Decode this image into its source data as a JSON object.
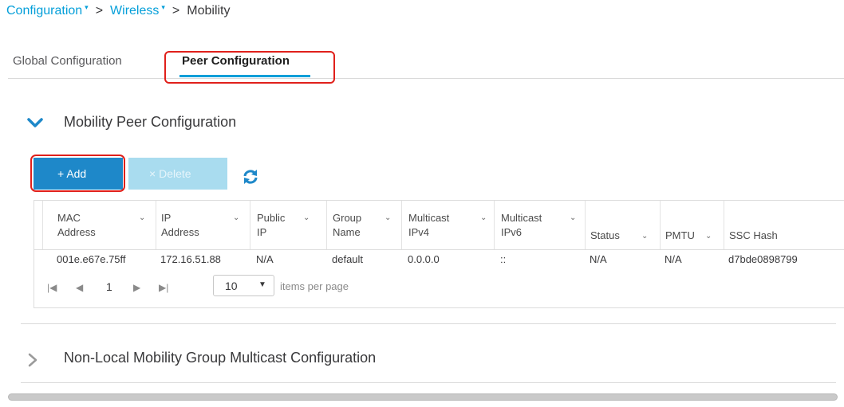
{
  "breadcrumb": {
    "items": [
      "Configuration",
      "Wireless",
      "Mobility"
    ],
    "caret": "▾",
    "separator": ">"
  },
  "tabs": [
    {
      "label": "Global Configuration",
      "active": false
    },
    {
      "label": "Peer Configuration",
      "active": true
    }
  ],
  "section": {
    "title": "Mobility Peer Configuration",
    "expanded": true
  },
  "toolbar": {
    "add_icon": "+",
    "add_label": "Add",
    "delete_icon": "×",
    "delete_label": "Delete",
    "refresh_icon": "refresh-icon"
  },
  "table": {
    "columns": [
      {
        "line1": "MAC",
        "line2": "Address"
      },
      {
        "line1": "IP",
        "line2": "Address"
      },
      {
        "line1": "Public",
        "line2": "IP"
      },
      {
        "line1": "Group",
        "line2": "Name"
      },
      {
        "line1": "Multicast",
        "line2": "IPv4"
      },
      {
        "line1": "Multicast",
        "line2": "IPv6"
      },
      {
        "line1": "",
        "line2": "Status"
      },
      {
        "line1": "",
        "line2": "PMTU"
      },
      {
        "line1": "",
        "line2": "SSC Hash"
      }
    ],
    "rows": [
      [
        "001e.e67e.75ff",
        "172.16.51.88",
        "N/A",
        "default",
        "0.0.0.0",
        "::",
        "N/A",
        "N/A",
        "d7bde0898799"
      ]
    ]
  },
  "pager": {
    "current_page": "1",
    "per_page": "10",
    "per_page_label": "items per page"
  },
  "section2": {
    "title": "Non-Local Mobility Group Multicast Configuration",
    "expanded": false
  },
  "colors": {
    "accent": "#049fd9",
    "add_button": "#1e88c9",
    "delete_button": "#a9dcef",
    "callout": "#e0201b"
  }
}
